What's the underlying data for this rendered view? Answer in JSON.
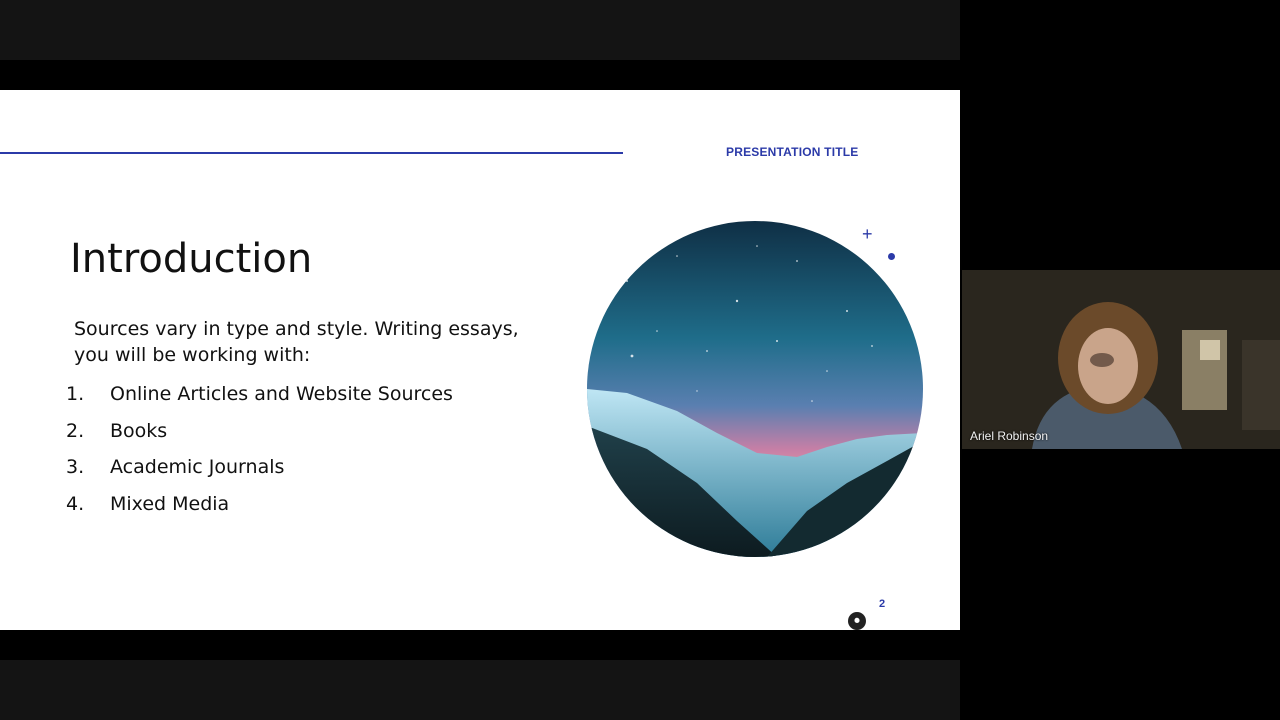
{
  "slide": {
    "header": "PRESENTATION TITLE",
    "title": "Introduction",
    "body": "Sources vary in type and style. Writing essays, you will be working with:",
    "list": [
      {
        "num": "1.",
        "text": "Online Articles and Website Sources"
      },
      {
        "num": "2.",
        "text": "Books"
      },
      {
        "num": "3.",
        "text": "Academic Journals"
      },
      {
        "num": "4.",
        "text": "Mixed Media"
      }
    ],
    "page_number": "2",
    "decor": {
      "plus": "+"
    },
    "accent_color": "#2b3aa8"
  },
  "participant": {
    "name": "Ariel Robinson"
  },
  "controls": {
    "fab_icon": "recording-icon"
  }
}
